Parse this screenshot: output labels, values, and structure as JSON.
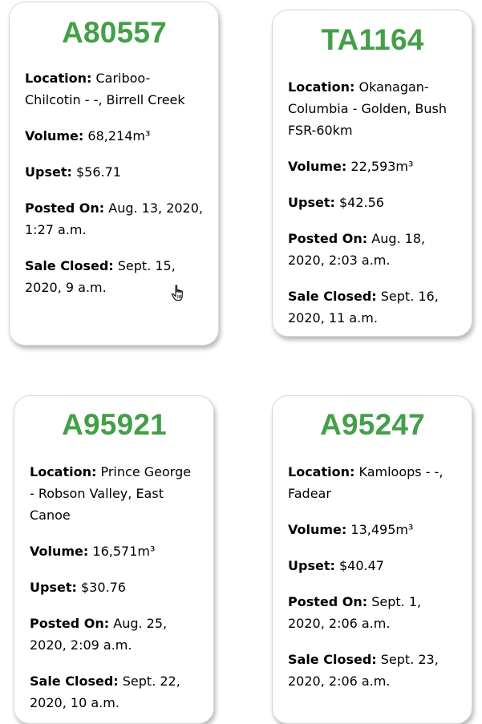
{
  "labels": {
    "location": "Location:",
    "volume": "Volume:",
    "upset": "Upset:",
    "posted_on": "Posted On:",
    "sale_closed": "Sale Closed:"
  },
  "colors": {
    "title": "#43a047",
    "card_border": "#d8d8d8",
    "text": "#000000"
  },
  "cursor_icon": "hand-pointer-icon",
  "cards": [
    {
      "id": "A80557",
      "location": "Cariboo-Chilcotin - -, Birrell Creek",
      "volume": "68,214m³",
      "upset": "$56.71",
      "posted_on": "Aug. 13, 2020, 1:27 a.m.",
      "sale_closed": "Sept. 15, 2020, 9 a.m."
    },
    {
      "id": "TA1164",
      "location": "Okanagan-Columbia - Golden, Bush FSR-60km",
      "volume": "22,593m³",
      "upset": "$42.56",
      "posted_on": "Aug. 18, 2020, 2:03 a.m.",
      "sale_closed": "Sept. 16, 2020, 11 a.m."
    },
    {
      "id": "A95921",
      "location": "Prince George - Robson Valley, East Canoe",
      "volume": "16,571m³",
      "upset": "$30.76",
      "posted_on": "Aug. 25, 2020, 2:09 a.m.",
      "sale_closed": "Sept. 22, 2020, 10 a.m."
    },
    {
      "id": "A95247",
      "location": "Kamloops - -, Fadear",
      "volume": "13,495m³",
      "upset": "$40.47",
      "posted_on": "Sept. 1, 2020, 2:06 a.m.",
      "sale_closed": "Sept. 23, 2020, 2:06 a.m."
    }
  ]
}
